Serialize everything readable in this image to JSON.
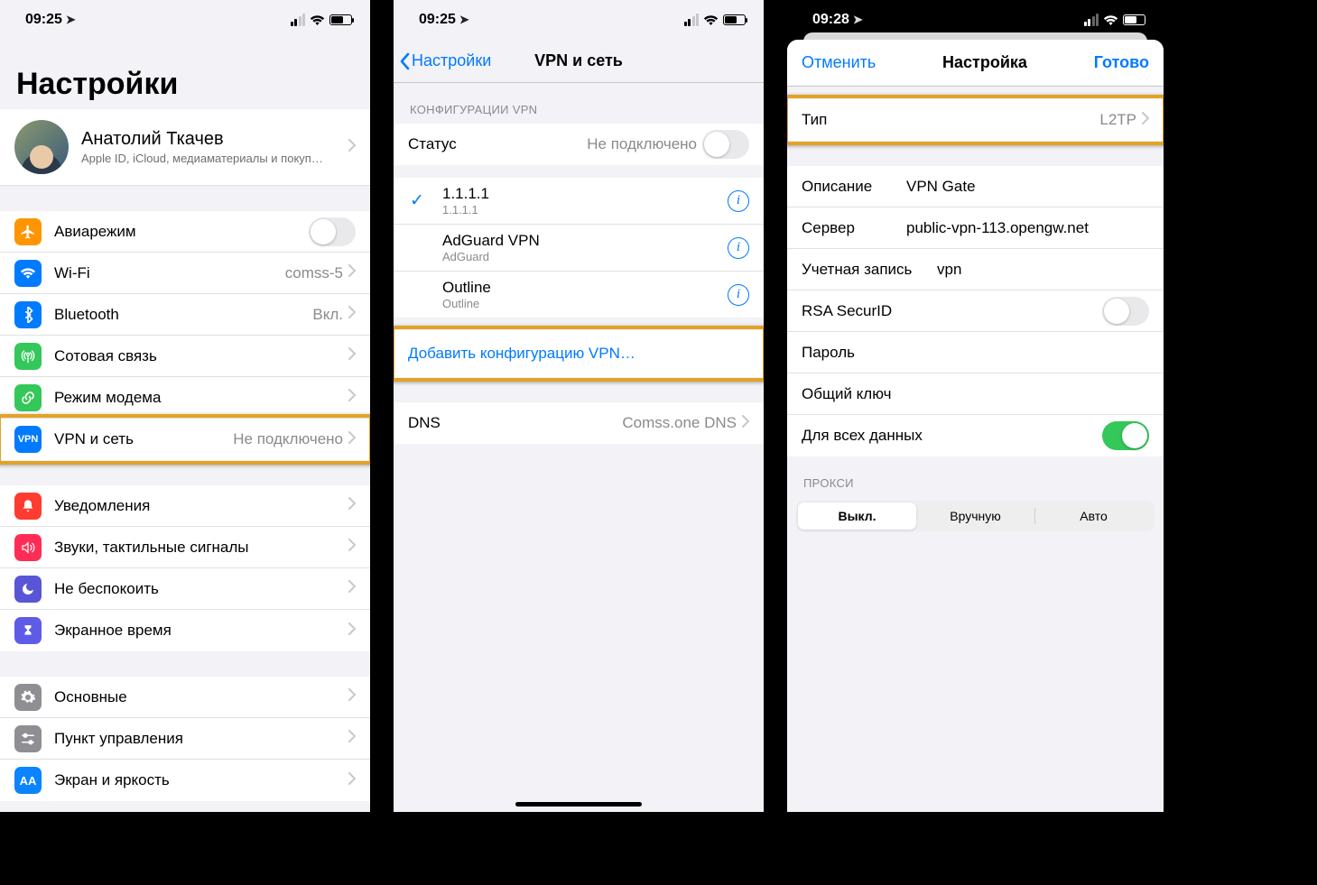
{
  "status_time_a": "09:25",
  "status_time_b": "09:25",
  "status_time_c": "09:28",
  "p1": {
    "title": "Настройки",
    "profile_name": "Анатолий Ткачев",
    "profile_sub": "Apple ID, iCloud, медиаматериалы и покуп…",
    "rows": {
      "airplane": "Авиарежим",
      "wifi": "Wi-Fi",
      "wifi_val": "comss-5",
      "bt": "Bluetooth",
      "bt_val": "Вкл.",
      "cell": "Сотовая связь",
      "hotspot": "Режим модема",
      "vpn": "VPN и сеть",
      "vpn_val": "Не подключено",
      "notif": "Уведомления",
      "sound": "Звуки, тактильные сигналы",
      "dnd": "Не беспокоить",
      "screentime": "Экранное время",
      "general": "Основные",
      "control": "Пункт управления",
      "display": "Экран и яркость"
    }
  },
  "p2": {
    "back": "Настройки",
    "title": "VPN и сеть",
    "section": "КОНФИГУРАЦИИ VPN",
    "status_label": "Статус",
    "status_val": "Не подключено",
    "vpn_items": [
      {
        "name": "1.1.1.1",
        "sub": "1.1.1.1",
        "selected": true
      },
      {
        "name": "AdGuard VPN",
        "sub": "AdGuard",
        "selected": false
      },
      {
        "name": "Outline",
        "sub": "Outline",
        "selected": false
      }
    ],
    "add_label": "Добавить конфигурацию VPN…",
    "dns": "DNS",
    "dns_val": "Comss.one DNS"
  },
  "p3": {
    "cancel": "Отменить",
    "title": "Настройка",
    "done": "Готово",
    "type_label": "Тип",
    "type_val": "L2TP",
    "fields": {
      "desc_l": "Описание",
      "desc_v": "VPN Gate",
      "server_l": "Сервер",
      "server_v": "public-vpn-113.opengw.net",
      "acct_l": "Учетная запись",
      "acct_v": "vpn",
      "rsa_l": "RSA SecurID",
      "pass_l": "Пароль",
      "secret_l": "Общий ключ",
      "alldata_l": "Для всех данных"
    },
    "proxy_head": "ПРОКСИ",
    "seg": [
      "Выкл.",
      "Вручную",
      "Авто"
    ]
  }
}
